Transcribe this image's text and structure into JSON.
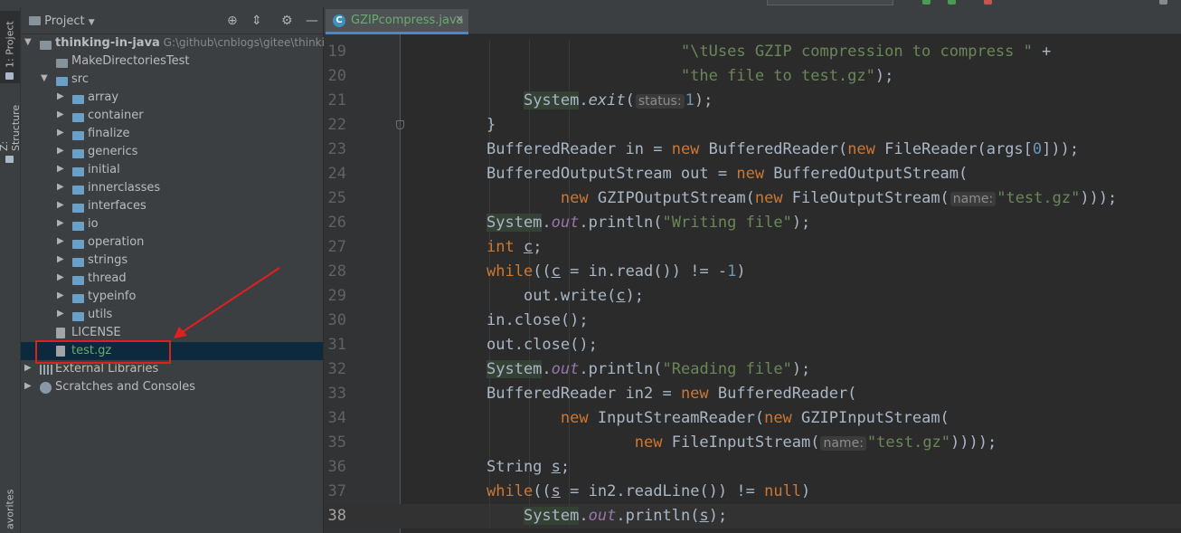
{
  "toolwindow_tabs": [
    {
      "label": "1: Project"
    },
    {
      "label": "Z: Structure"
    },
    {
      "label": "avorites"
    }
  ],
  "project": {
    "header_title": "Project",
    "header_icons": [
      "target-icon",
      "collapse-icon",
      "gear-icon",
      "minimize-icon"
    ],
    "tree": [
      {
        "label": "thinking-in-java",
        "path": "G:\\github\\cnblogs\\gitee\\thinking",
        "depth": 0,
        "arrow": "▼",
        "icon": "module-folder-icon"
      },
      {
        "label": "MakeDirectoriesTest",
        "depth": 1,
        "arrow": "",
        "icon": "folder-icon"
      },
      {
        "label": "src",
        "depth": 1,
        "arrow": "▼",
        "icon": "source-folder-icon"
      },
      {
        "label": "array",
        "depth": 2,
        "arrow": "▶",
        "icon": "package-icon"
      },
      {
        "label": "container",
        "depth": 2,
        "arrow": "▶",
        "icon": "package-icon"
      },
      {
        "label": "finalize",
        "depth": 2,
        "arrow": "▶",
        "icon": "package-icon"
      },
      {
        "label": "generics",
        "depth": 2,
        "arrow": "▶",
        "icon": "package-icon"
      },
      {
        "label": "initial",
        "depth": 2,
        "arrow": "▶",
        "icon": "package-icon"
      },
      {
        "label": "innerclasses",
        "depth": 2,
        "arrow": "▶",
        "icon": "package-icon"
      },
      {
        "label": "interfaces",
        "depth": 2,
        "arrow": "▶",
        "icon": "package-icon"
      },
      {
        "label": "io",
        "depth": 2,
        "arrow": "▶",
        "icon": "package-icon"
      },
      {
        "label": "operation",
        "depth": 2,
        "arrow": "▶",
        "icon": "package-icon"
      },
      {
        "label": "strings",
        "depth": 2,
        "arrow": "▶",
        "icon": "package-icon"
      },
      {
        "label": "thread",
        "depth": 2,
        "arrow": "▶",
        "icon": "package-icon"
      },
      {
        "label": "typeinfo",
        "depth": 2,
        "arrow": "▶",
        "icon": "package-icon"
      },
      {
        "label": "utils",
        "depth": 2,
        "arrow": "▶",
        "icon": "package-icon"
      },
      {
        "label": "LICENSE",
        "depth": 1,
        "arrow": "",
        "icon": "text-file-icon"
      },
      {
        "label": "test.gz",
        "depth": 1,
        "arrow": "",
        "icon": "unknown-file-icon",
        "selected": true
      },
      {
        "label": "External Libraries",
        "depth": 0,
        "arrow": "▶",
        "icon": "library-icon"
      },
      {
        "label": "Scratches and Consoles",
        "depth": 0,
        "arrow": "▶",
        "icon": "scratches-icon"
      }
    ]
  },
  "editor": {
    "tab": {
      "label": "GZIPcompress.java",
      "close": "×",
      "icon_letter": "C"
    },
    "current_line": "38",
    "lines": [
      {
        "no": "19",
        "indent": "                     ",
        "tokens": [
          {
            "t": "\"\\tUses GZIP compression to compress \"",
            "c": "str"
          },
          {
            "t": " +",
            "c": ""
          }
        ]
      },
      {
        "no": "20",
        "indent": "                     ",
        "tokens": [
          {
            "t": "\"the file to test.gz\"",
            "c": "str"
          },
          {
            "t": ");",
            "c": ""
          }
        ]
      },
      {
        "no": "21",
        "indent": "    ",
        "tokens": [
          {
            "t": "System",
            "c": "hl"
          },
          {
            "t": ".",
            "c": ""
          },
          {
            "t": "exit",
            "c": "it"
          },
          {
            "t": "(",
            "c": ""
          },
          {
            "t": "status:",
            "c": "hint"
          },
          {
            "t": "1",
            "c": "num"
          },
          {
            "t": ");",
            "c": ""
          }
        ]
      },
      {
        "no": "22",
        "indent": "",
        "tokens": [
          {
            "t": "}",
            "c": ""
          }
        ]
      },
      {
        "no": "23",
        "indent": "",
        "tokens": [
          {
            "t": "BufferedReader in = ",
            "c": ""
          },
          {
            "t": "new",
            "c": "kw"
          },
          {
            "t": " BufferedReader(",
            "c": ""
          },
          {
            "t": "new",
            "c": "kw"
          },
          {
            "t": " FileReader(args[",
            "c": ""
          },
          {
            "t": "0",
            "c": "num"
          },
          {
            "t": "]));",
            "c": ""
          }
        ]
      },
      {
        "no": "24",
        "indent": "",
        "tokens": [
          {
            "t": "BufferedOutputStream out = ",
            "c": ""
          },
          {
            "t": "new",
            "c": "kw"
          },
          {
            "t": " BufferedOutputStream(",
            "c": ""
          }
        ]
      },
      {
        "no": "25",
        "indent": "        ",
        "tokens": [
          {
            "t": "new",
            "c": "kw"
          },
          {
            "t": " GZIPOutputStream(",
            "c": ""
          },
          {
            "t": "new",
            "c": "kw"
          },
          {
            "t": " FileOutputStream(",
            "c": ""
          },
          {
            "t": "name:",
            "c": "hint"
          },
          {
            "t": "\"test.gz\"",
            "c": "str"
          },
          {
            "t": ")));",
            "c": ""
          }
        ]
      },
      {
        "no": "26",
        "indent": "",
        "tokens": [
          {
            "t": "System",
            "c": "hl"
          },
          {
            "t": ".",
            "c": ""
          },
          {
            "t": "out",
            "c": "fld"
          },
          {
            "t": ".println(",
            "c": ""
          },
          {
            "t": "\"Writing file\"",
            "c": "str"
          },
          {
            "t": ");",
            "c": ""
          }
        ]
      },
      {
        "no": "27",
        "indent": "",
        "tokens": [
          {
            "t": "int",
            "c": "kw"
          },
          {
            "t": " ",
            "c": ""
          },
          {
            "t": "c",
            "c": "var"
          },
          {
            "t": ";",
            "c": ""
          }
        ]
      },
      {
        "no": "28",
        "indent": "",
        "tokens": [
          {
            "t": "while",
            "c": "kw"
          },
          {
            "t": "((",
            "c": ""
          },
          {
            "t": "c",
            "c": "var"
          },
          {
            "t": " = in.read()) != -",
            "c": ""
          },
          {
            "t": "1",
            "c": "num"
          },
          {
            "t": ")",
            "c": ""
          }
        ]
      },
      {
        "no": "29",
        "indent": "    ",
        "tokens": [
          {
            "t": "out.write(",
            "c": ""
          },
          {
            "t": "c",
            "c": "var"
          },
          {
            "t": ");",
            "c": ""
          }
        ]
      },
      {
        "no": "30",
        "indent": "",
        "tokens": [
          {
            "t": "in.close();",
            "c": ""
          }
        ]
      },
      {
        "no": "31",
        "indent": "",
        "tokens": [
          {
            "t": "out.close();",
            "c": ""
          }
        ]
      },
      {
        "no": "32",
        "indent": "",
        "tokens": [
          {
            "t": "System",
            "c": "hl"
          },
          {
            "t": ".",
            "c": ""
          },
          {
            "t": "out",
            "c": "fld"
          },
          {
            "t": ".println(",
            "c": ""
          },
          {
            "t": "\"Reading file\"",
            "c": "str"
          },
          {
            "t": ");",
            "c": ""
          }
        ]
      },
      {
        "no": "33",
        "indent": "",
        "tokens": [
          {
            "t": "BufferedReader in2 = ",
            "c": ""
          },
          {
            "t": "new",
            "c": "kw"
          },
          {
            "t": " BufferedReader(",
            "c": ""
          }
        ]
      },
      {
        "no": "34",
        "indent": "        ",
        "tokens": [
          {
            "t": "new",
            "c": "kw"
          },
          {
            "t": " InputStreamReader(",
            "c": ""
          },
          {
            "t": "new",
            "c": "kw"
          },
          {
            "t": " GZIPInputStream(",
            "c": ""
          }
        ]
      },
      {
        "no": "35",
        "indent": "                ",
        "tokens": [
          {
            "t": "new",
            "c": "kw"
          },
          {
            "t": " FileInputStream(",
            "c": ""
          },
          {
            "t": "name:",
            "c": "hint"
          },
          {
            "t": "\"test.gz\"",
            "c": "str"
          },
          {
            "t": "))));",
            "c": ""
          }
        ]
      },
      {
        "no": "36",
        "indent": "",
        "tokens": [
          {
            "t": "String ",
            "c": ""
          },
          {
            "t": "s",
            "c": "var"
          },
          {
            "t": ";",
            "c": ""
          }
        ]
      },
      {
        "no": "37",
        "indent": "",
        "tokens": [
          {
            "t": "while",
            "c": "kw"
          },
          {
            "t": "((",
            "c": ""
          },
          {
            "t": "s",
            "c": "var"
          },
          {
            "t": " = in2.readLine()) != ",
            "c": ""
          },
          {
            "t": "null",
            "c": "kw"
          },
          {
            "t": ")",
            "c": ""
          }
        ]
      },
      {
        "no": "38",
        "indent": "    ",
        "tokens": [
          {
            "t": "System",
            "c": "hl"
          },
          {
            "t": ".",
            "c": ""
          },
          {
            "t": "out",
            "c": "fld"
          },
          {
            "t": ".println(",
            "c": ""
          },
          {
            "t": "s",
            "c": "var"
          },
          {
            "t": ");",
            "c": ""
          }
        ]
      }
    ]
  },
  "colors": {
    "editor_bg": "#2b2b2b",
    "panel_bg": "#3c3f41",
    "selection": "#0d293e",
    "keyword": "#cc7832",
    "string": "#6a8759",
    "number": "#6897bb",
    "field": "#9876aa",
    "annotation": "#e02020"
  }
}
